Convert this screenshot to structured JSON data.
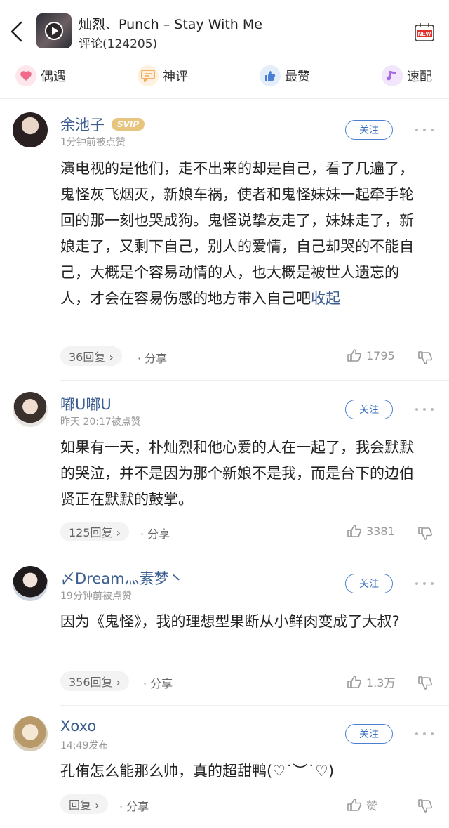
{
  "header": {
    "song_title": "灿烈、Punch – Stay With Me",
    "subtitle": "评论(124205)",
    "new_badge": "NEW"
  },
  "tabs": [
    {
      "label": "偶遇",
      "icon": "heart-icon",
      "color": "#f06a8a"
    },
    {
      "label": "神评",
      "icon": "chat-icon",
      "color": "#f3a44f"
    },
    {
      "label": "最赞",
      "icon": "thumb-up-icon",
      "color": "#4a7fd1"
    },
    {
      "label": "速配",
      "icon": "music-note-icon",
      "color": "#a56be0"
    }
  ],
  "comments": [
    {
      "username": "余池子",
      "badge": "SVIP",
      "meta": "1分钟前被点赞",
      "follow_label": "关注",
      "text": "演电视的是他们，走不出来的却是自己，看了几遍了，鬼怪灰飞烟灭，新娘车祸，使者和鬼怪妹妹一起牵手轮回的那一刻也哭成狗。鬼怪说挚友走了，妹妹走了，新娘走了，又剩下自己，别人的爱情，自己却哭的不能自己，大概是个容易动情的人，也大概是被世人遗忘的人，才会在容易伤感的地方带入自己吧",
      "collapse": "收起",
      "replies": "36回复 ›",
      "share": "· 分享",
      "likes": "1795"
    },
    {
      "username": "嘟U嘟U",
      "badge": "",
      "meta": "昨天 20:17被点赞",
      "follow_label": "关注",
      "text": "如果有一天，朴灿烈和他心爱的人在一起了，我会默默的哭泣，并不是因为那个新娘不是我，而是台下的边伯贤正在默默的鼓掌。",
      "collapse": "",
      "replies": "125回复 ›",
      "share": "· 分享",
      "likes": "3381"
    },
    {
      "username": "〆Dream灬素梦丶",
      "badge": "",
      "meta": "19分钟前被点赞",
      "follow_label": "关注",
      "text": "因为《鬼怪》，我的理想型果断从小鲜肉变成了大叔?",
      "collapse": "",
      "replies": "356回复 ›",
      "share": "· 分享",
      "likes": "1.3万"
    },
    {
      "username": "Xoxo",
      "badge": "",
      "meta": "14:49发布",
      "follow_label": "关注",
      "text": "孔侑怎么能那么帅，真的超甜鸭(♡˙︶˙♡)",
      "collapse": "",
      "replies": "回复 ›",
      "share": "· 分享",
      "likes": "赞"
    }
  ],
  "colors": {
    "link": "#3b5d8f",
    "follow_border": "#4a7fd1",
    "svip": "#e8c57e",
    "new_badge": "#e0312b"
  }
}
